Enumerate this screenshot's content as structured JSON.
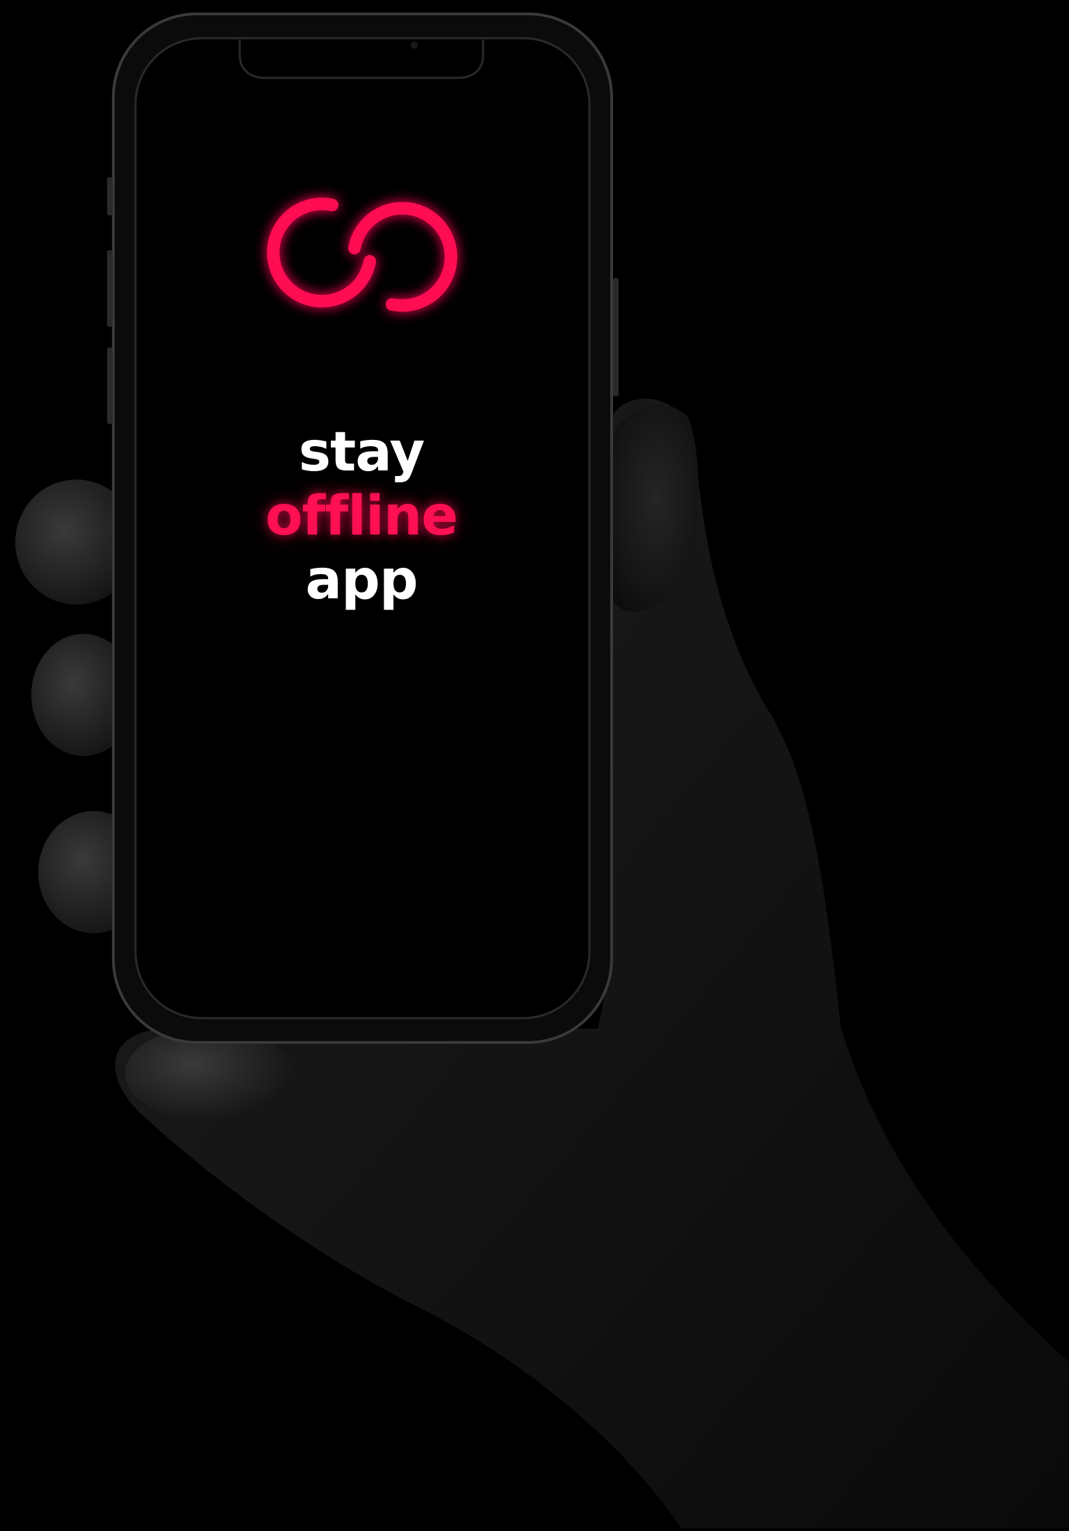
{
  "app": {
    "logo_icon": "linked-rings-logo-icon",
    "accent_color": "#ff1053"
  },
  "tagline": {
    "line1": "stay",
    "line2": "offline",
    "line3": "app"
  }
}
